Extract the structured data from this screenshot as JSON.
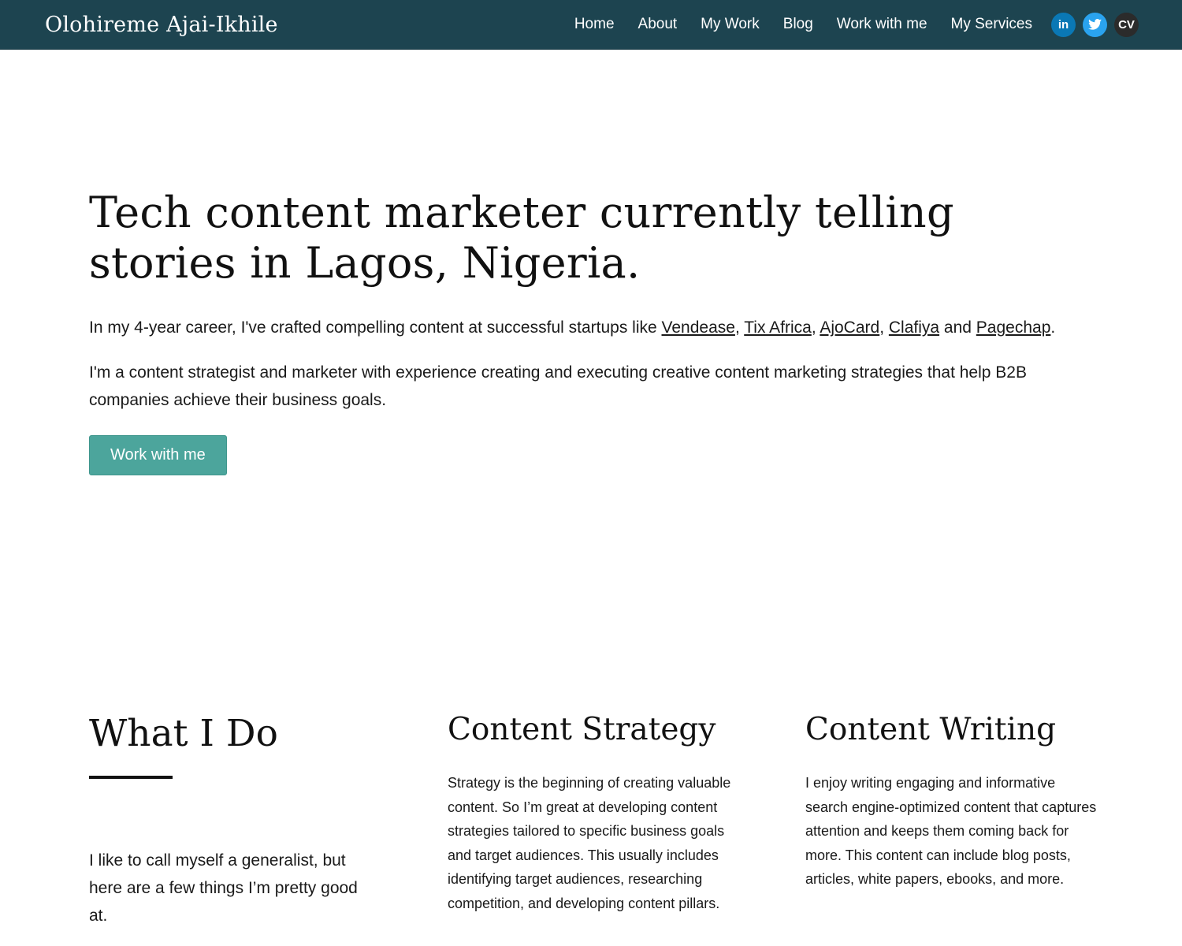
{
  "header": {
    "brand": "Olohireme Ajai-Ikhile",
    "nav": [
      "Home",
      "About",
      "My Work",
      "Blog",
      "Work with me",
      "My Services"
    ],
    "social": {
      "linkedin": "in",
      "twitter_icon": "twitter-bird-icon",
      "cv": "CV"
    }
  },
  "hero": {
    "title": "Tech content marketer currently telling stories in Lagos, Nigeria.",
    "intro_prefix": "In my 4-year career, I've crafted compelling content at successful startups like ",
    "companies": [
      "Vendease",
      "Tix Africa",
      "AjoCard",
      "Clafiya",
      "Pagechap"
    ],
    "sep_comma": ", ",
    "sep_and": " and ",
    "intro_suffix": ".",
    "description": "I'm a content strategist and marketer with experience creating and executing creative content marketing strategies that help B2B companies achieve their business goals.",
    "cta": "Work with me"
  },
  "what_i_do": {
    "title": "What I Do",
    "text": "I like to call myself a generalist, but here are a few things I’m pretty good at."
  },
  "services": [
    {
      "title": "Content Strategy",
      "text": "Strategy is the beginning of creating valuable content. So I’m great at developing content strategies tailored to specific business goals and target audiences. This usually includes identifying target audiences, researching competition, and developing content pillars."
    },
    {
      "title": "Content Writing",
      "text": "I enjoy writing engaging and informative search engine-optimized content that captures attention and keeps them coming back for more. This content can include blog posts, articles, white papers, ebooks, and more."
    }
  ],
  "colors": {
    "navbar": "#1d4450",
    "accent": "#4ca59c",
    "linkedin": "#0a78b5",
    "twitter": "#2aa3ef"
  }
}
